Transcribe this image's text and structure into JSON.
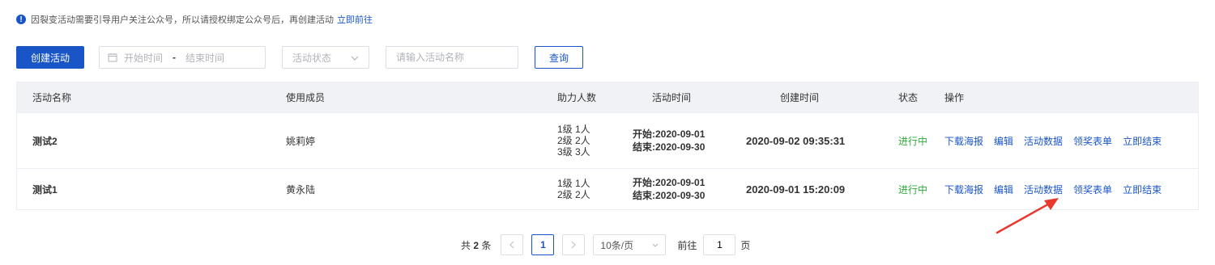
{
  "notice": {
    "icon": "info-icon",
    "text": "因裂变活动需要引导用户关注公众号，所以请授权绑定公众号后，再创建活动",
    "link": "立即前往"
  },
  "toolbar": {
    "create_label": "创建活动",
    "date_start_placeholder": "开始时间",
    "date_separator": "-",
    "date_end_placeholder": "结束时间",
    "status_placeholder": "活动状态",
    "name_placeholder": "请输入活动名称",
    "query_label": "查询"
  },
  "table": {
    "headers": {
      "name": "活动名称",
      "member": "使用成员",
      "helpers": "助力人数",
      "time": "活动时间",
      "created": "创建时间",
      "status": "状态",
      "ops": "操作"
    },
    "rows": [
      {
        "name": "测试2",
        "member": "姚莉婷",
        "helpers": [
          "1级 1人",
          "2级 2人",
          "3级 3人"
        ],
        "start": "开始:2020-09-01",
        "end": "结束:2020-09-30",
        "created": "2020-09-02 09:35:31",
        "status": "进行中",
        "ops": [
          "下载海报",
          "编辑",
          "活动数据",
          "领奖表单",
          "立即结束"
        ]
      },
      {
        "name": "测试1",
        "member": "黄永陆",
        "helpers": [
          "1级 1人",
          "2级 2人"
        ],
        "start": "开始:2020-09-01",
        "end": "结束:2020-09-30",
        "created": "2020-09-01 15:20:09",
        "status": "进行中",
        "ops": [
          "下载海报",
          "编辑",
          "活动数据",
          "领奖表单",
          "立即结束"
        ]
      }
    ]
  },
  "pagination": {
    "total_prefix": "共",
    "total_count": "2",
    "total_suffix": "条",
    "current_page": "1",
    "page_size": "10条/页",
    "goto_label": "前往",
    "goto_value": "1",
    "page_suffix": "页"
  },
  "colors": {
    "primary": "#1a55c8",
    "status_active": "#2eaa3c",
    "annotation_arrow": "#e8392e"
  }
}
